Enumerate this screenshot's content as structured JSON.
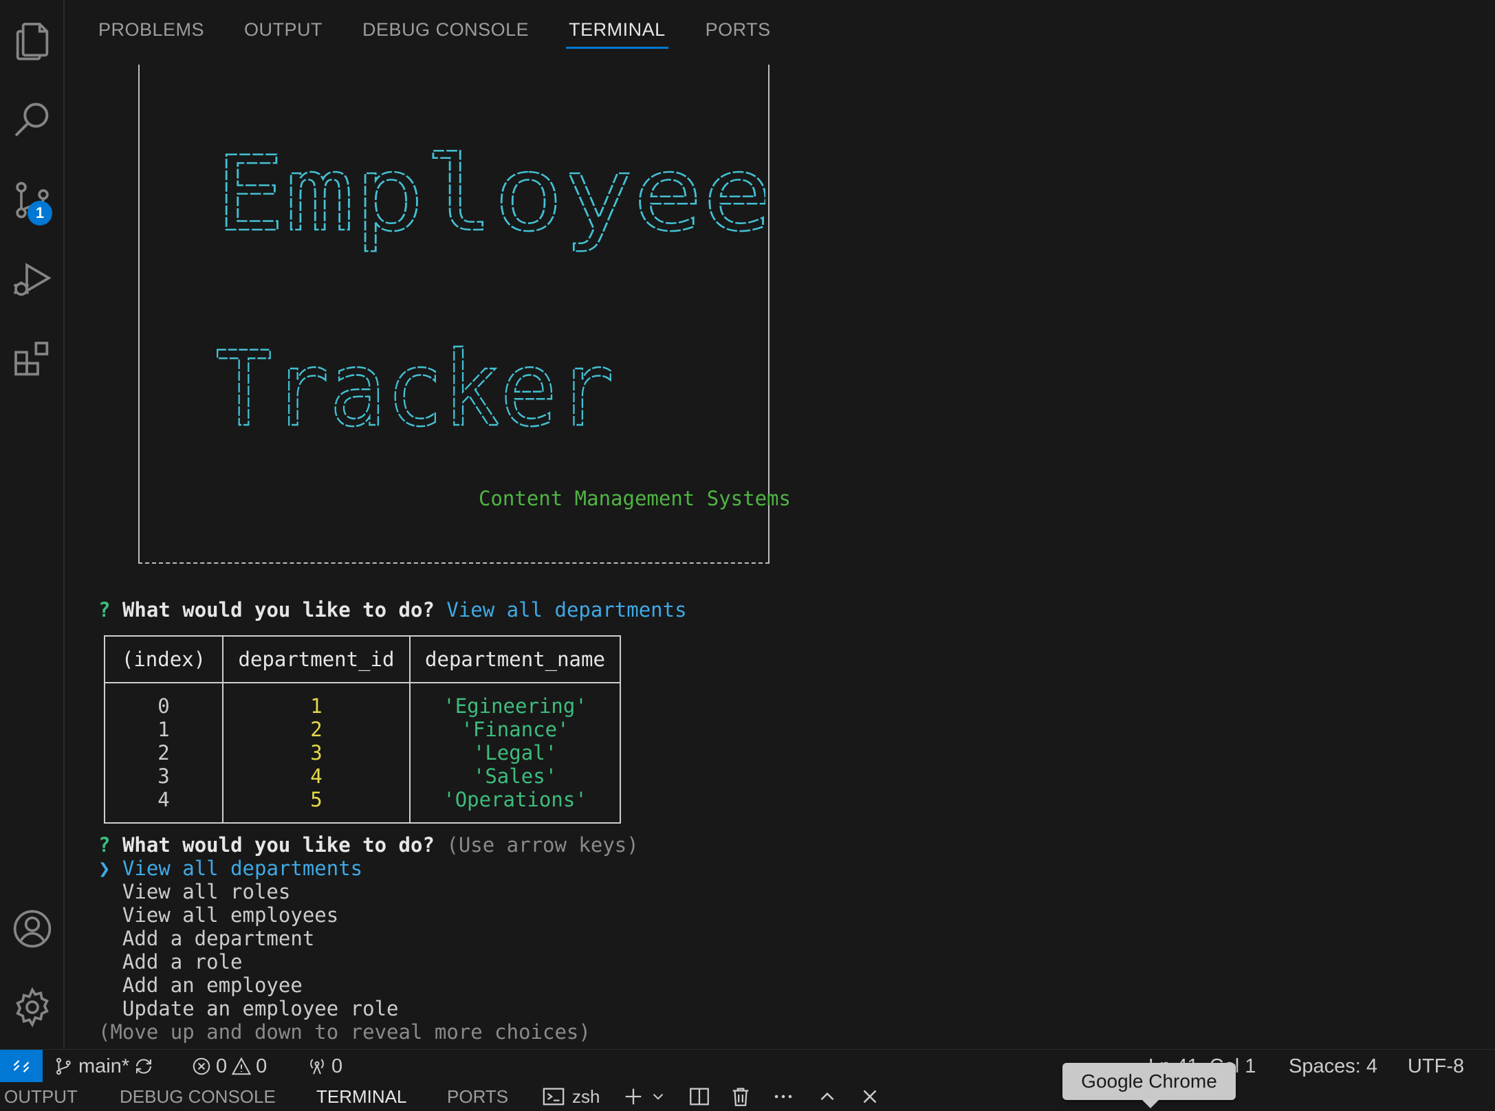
{
  "panel": {
    "tabs": [
      {
        "label": "PROBLEMS"
      },
      {
        "label": "OUTPUT"
      },
      {
        "label": "DEBUG CONSOLE"
      },
      {
        "label": "TERMINAL",
        "active": true
      },
      {
        "label": "PORTS"
      }
    ]
  },
  "activity_bar": {
    "icons": [
      "explorer-icon",
      "search-icon",
      "source-control-icon",
      "run-debug-icon",
      "extensions-icon",
      "accounts-icon",
      "manage-gear-icon"
    ],
    "source_control_badge": "1"
  },
  "terminal": {
    "banner": {
      "title_word_1": "Employee",
      "title_word_2": "Tracker",
      "subtitle": "Content Management Systems"
    },
    "prompt_1": {
      "marker": "?",
      "question": "What would you like to do?",
      "answer": "View all departments"
    },
    "table": {
      "headers": [
        "(index)",
        "department_id",
        "department_name"
      ],
      "rows": [
        {
          "index": "0",
          "department_id": "1",
          "department_name": "'Egineering'"
        },
        {
          "index": "1",
          "department_id": "2",
          "department_name": "'Finance'"
        },
        {
          "index": "2",
          "department_id": "3",
          "department_name": "'Legal'"
        },
        {
          "index": "3",
          "department_id": "4",
          "department_name": "'Sales'"
        },
        {
          "index": "4",
          "department_id": "5",
          "department_name": "'Operations'"
        }
      ]
    },
    "prompt_2": {
      "marker": "?",
      "question": "What would you like to do?",
      "hint": "(Use arrow keys)",
      "pointer": "❯",
      "choices": [
        "View all departments",
        "View all roles",
        "View all employees",
        "Add a department",
        "Add a role",
        "Add an employee",
        "Update an employee role"
      ],
      "footer": "(Move up and down to reveal more choices)"
    }
  },
  "status_bar": {
    "branch": "main*",
    "errors": "0",
    "warnings": "0",
    "ports": "0",
    "cursor_position": "Ln 41, Col 1",
    "spaces": "Spaces: 4",
    "encoding": "UTF-8",
    "accent_color": "#0078d4"
  },
  "bottom_panel": {
    "tabs": [
      "OUTPUT",
      "DEBUG CONSOLE",
      "TERMINAL",
      "PORTS"
    ],
    "shell": "zsh"
  },
  "tooltip": {
    "text": "Google Chrome"
  }
}
